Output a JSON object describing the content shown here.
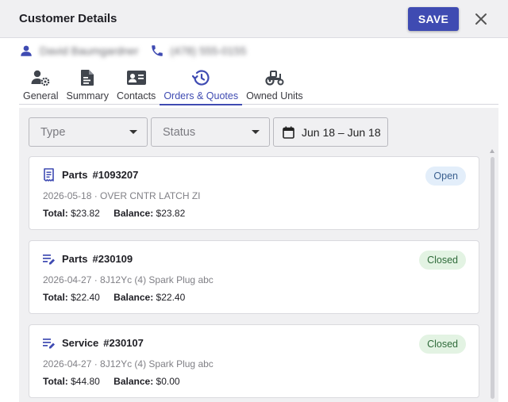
{
  "header": {
    "title": "Customer Details",
    "save_label": "SAVE"
  },
  "customer": {
    "name": "David Baumgardner",
    "phone": "(478) 555-0155"
  },
  "tabs": [
    {
      "label": "General",
      "icon": "user-gear-icon",
      "active": false
    },
    {
      "label": "Summary",
      "icon": "file-icon",
      "active": false
    },
    {
      "label": "Contacts",
      "icon": "contact-card-icon",
      "active": false
    },
    {
      "label": "Orders & Quotes",
      "icon": "history-icon",
      "active": true
    },
    {
      "label": "Owned Units",
      "icon": "tractor-icon",
      "active": false
    }
  ],
  "filters": {
    "type_placeholder": "Type",
    "status_placeholder": "Status",
    "date_range": "Jun 18 – Jun 18"
  },
  "orders": [
    {
      "kind": "Parts",
      "number": "#1093207",
      "icon": "receipt-icon",
      "meta": "2026-05-18 · OVER CNTR LATCH ZI",
      "total_label": "Total:",
      "total": "$23.82",
      "balance_label": "Balance:",
      "balance": "$23.82",
      "status": "Open"
    },
    {
      "kind": "Parts",
      "number": "#230109",
      "icon": "edit-note-icon",
      "meta": "2026-04-27 · 8J12Yc (4) Spark Plug abc",
      "total_label": "Total:",
      "total": "$22.40",
      "balance_label": "Balance:",
      "balance": "$22.40",
      "status": "Closed"
    },
    {
      "kind": "Service",
      "number": "#230107",
      "icon": "edit-note-icon",
      "meta": "2026-04-27 · 8J12Yc (4) Spark Plug abc",
      "total_label": "Total:",
      "total": "$44.80",
      "balance_label": "Balance:",
      "balance": "$0.00",
      "status": "Closed"
    }
  ],
  "colors": {
    "accent": "#3f4bb2",
    "open_bg": "#e3eefa",
    "open_text": "#3a5f8f",
    "closed_bg": "#e3f3e3",
    "closed_text": "#2f6b3a"
  }
}
